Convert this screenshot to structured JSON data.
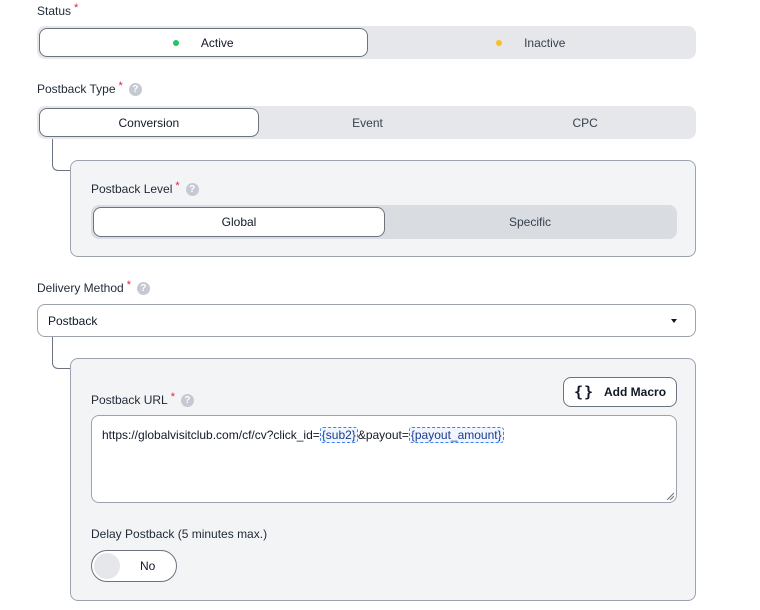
{
  "status": {
    "label": "Status",
    "required_mark": "*",
    "options": [
      {
        "label": "Active",
        "dot_color": "#22c55e",
        "selected": true
      },
      {
        "label": "Inactive",
        "dot_color": "#fbbf24",
        "selected": false
      }
    ]
  },
  "postback_type": {
    "label": "Postback Type",
    "required_mark": "*",
    "help": "?",
    "options": [
      {
        "label": "Conversion",
        "selected": true
      },
      {
        "label": "Event",
        "selected": false
      },
      {
        "label": "CPC",
        "selected": false
      }
    ]
  },
  "postback_level": {
    "label": "Postback Level",
    "required_mark": "*",
    "help": "?",
    "options": [
      {
        "label": "Global",
        "selected": true
      },
      {
        "label": "Specific",
        "selected": false
      }
    ]
  },
  "delivery_method": {
    "label": "Delivery Method",
    "required_mark": "*",
    "help": "?",
    "value": "Postback"
  },
  "postback_url": {
    "label": "Postback URL",
    "required_mark": "*",
    "help": "?",
    "add_macro_label": "Add Macro",
    "add_macro_icon": "{}",
    "url_prefix": "https://globalvisitclub.com/cf/cv?click_id=",
    "macro_1": "{sub2}",
    "url_middle": "&payout=",
    "macro_2": "{payout_amount}"
  },
  "delay_postback": {
    "label": "Delay Postback (5 minutes max.)",
    "toggle_value": "No"
  }
}
